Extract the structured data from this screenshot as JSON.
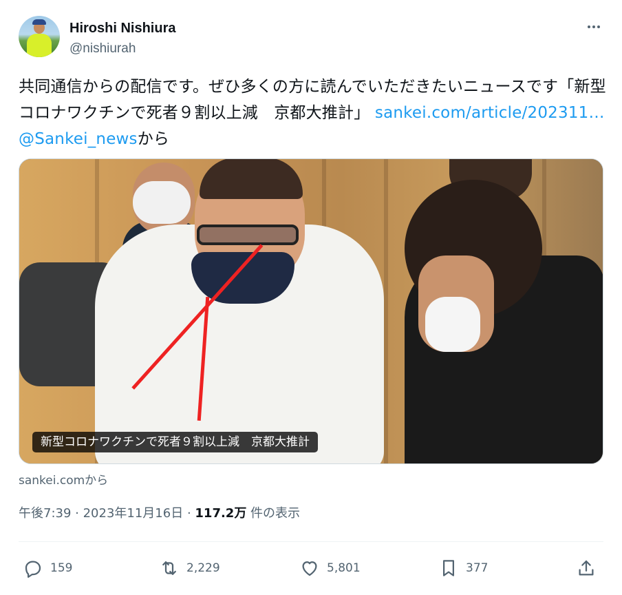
{
  "author": {
    "name": "Hiroshi Nishiura",
    "handle": "@nishiurah"
  },
  "tweet": {
    "text_main": "共同通信からの配信です。ぜひ多くの方に読んでいただきたいニュースです「新型コロナワクチンで死者９割以上減　京都大推計」 ",
    "link_1": "sankei.com/article/202311…",
    "space": " ",
    "link_2": "@Sankei_news",
    "text_tail": "から"
  },
  "card": {
    "overlay_title": "新型コロナワクチンで死者９割以上減　京都大推計",
    "source": "sankei.comから"
  },
  "meta": {
    "time": "午後7:39",
    "sep1": " · ",
    "date": "2023年11月16日",
    "sep2": " · ",
    "views_count": "117.2万",
    "views_label": " 件の表示"
  },
  "actions": {
    "reply_count": "159",
    "retweet_count": "2,229",
    "like_count": "5,801",
    "bookmark_count": "377"
  },
  "icons": [
    "more-icon",
    "reply-icon",
    "retweet-icon",
    "like-icon",
    "bookmark-icon",
    "share-icon"
  ],
  "colors": {
    "link": "#1d9bf0",
    "secondary_text": "#536471",
    "primary_text": "#0f1419"
  }
}
